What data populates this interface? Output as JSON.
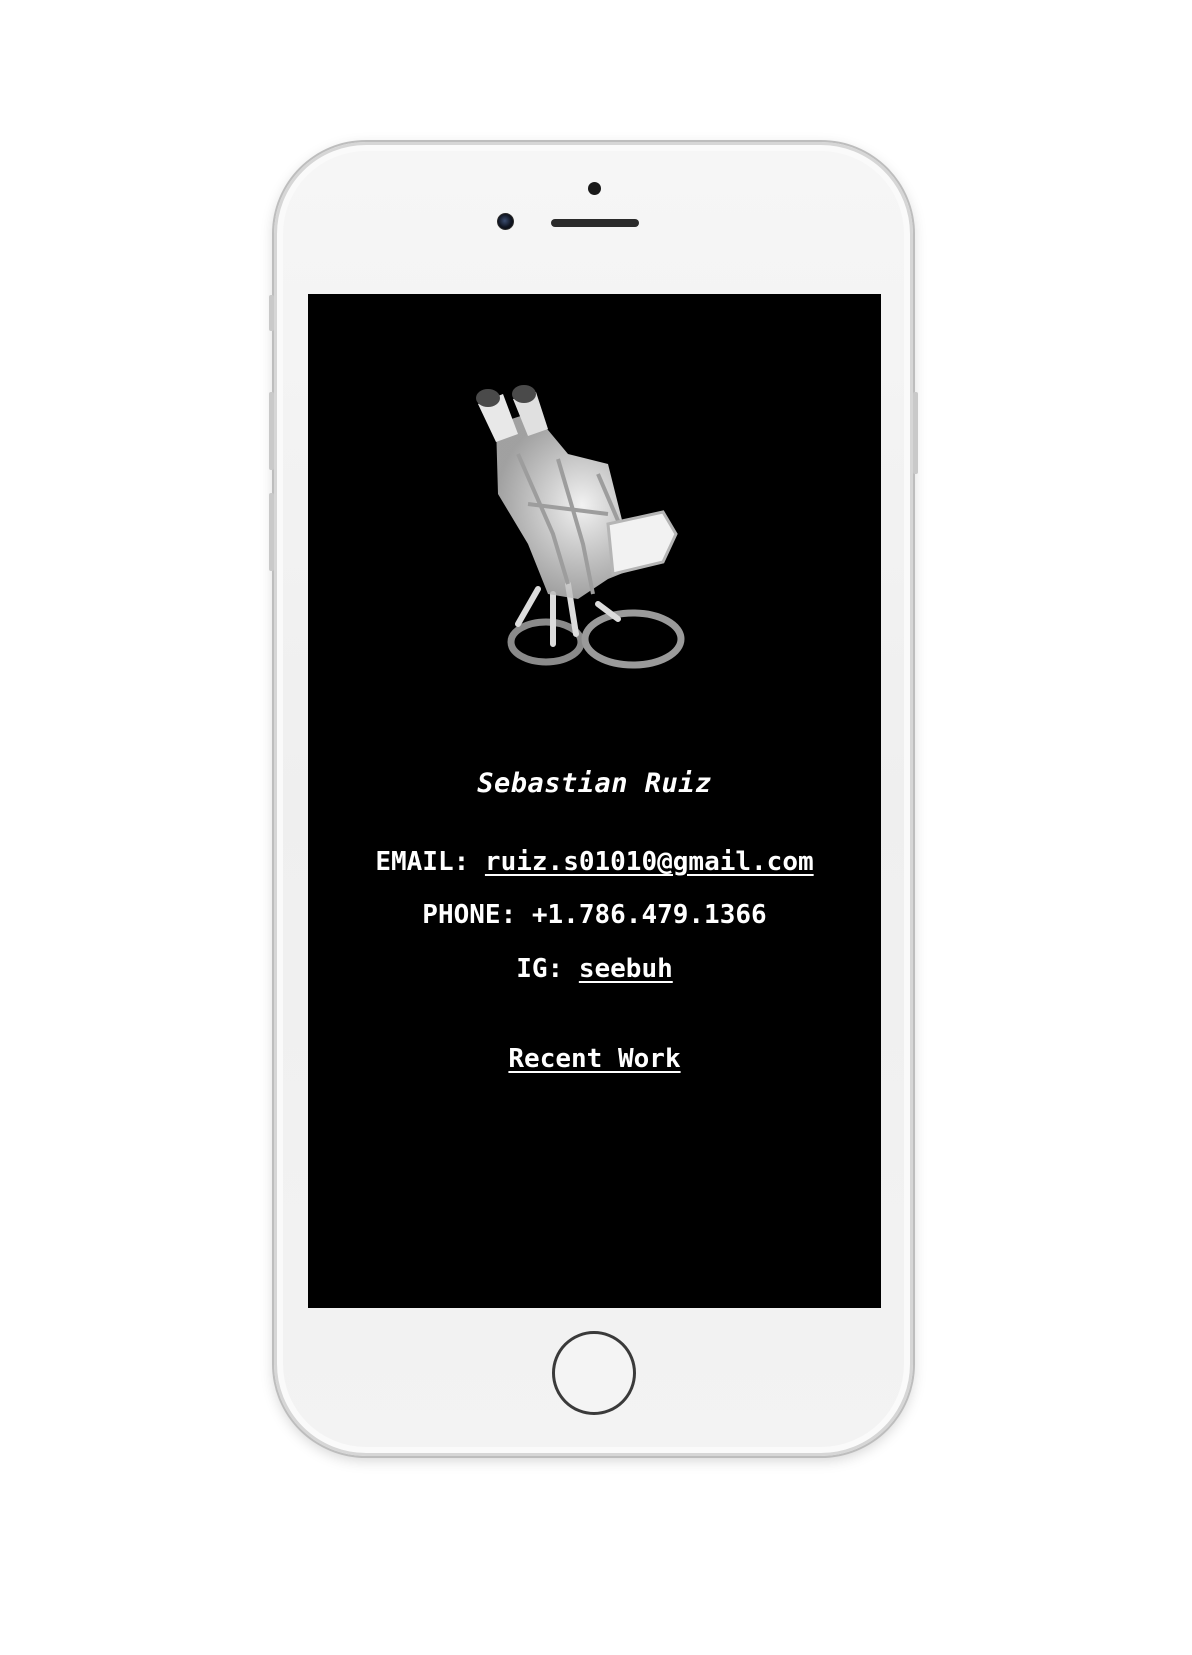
{
  "profile": {
    "name": "Sebastian Ruiz"
  },
  "contact": {
    "email_label": "EMAIL: ",
    "email_value": "ruiz.s01010@gmail.com",
    "phone_label": "PHONE: ",
    "phone_value": "+1.786.479.1366",
    "ig_label": "IG: ",
    "ig_value": "seebuh"
  },
  "nav": {
    "recent_work": "Recent Work"
  },
  "artwork": {
    "description_icon": "harness-sculpture-image"
  },
  "colors": {
    "screen_bg": "#000000",
    "text": "#ffffff",
    "device_body": "#f2f2f2"
  }
}
